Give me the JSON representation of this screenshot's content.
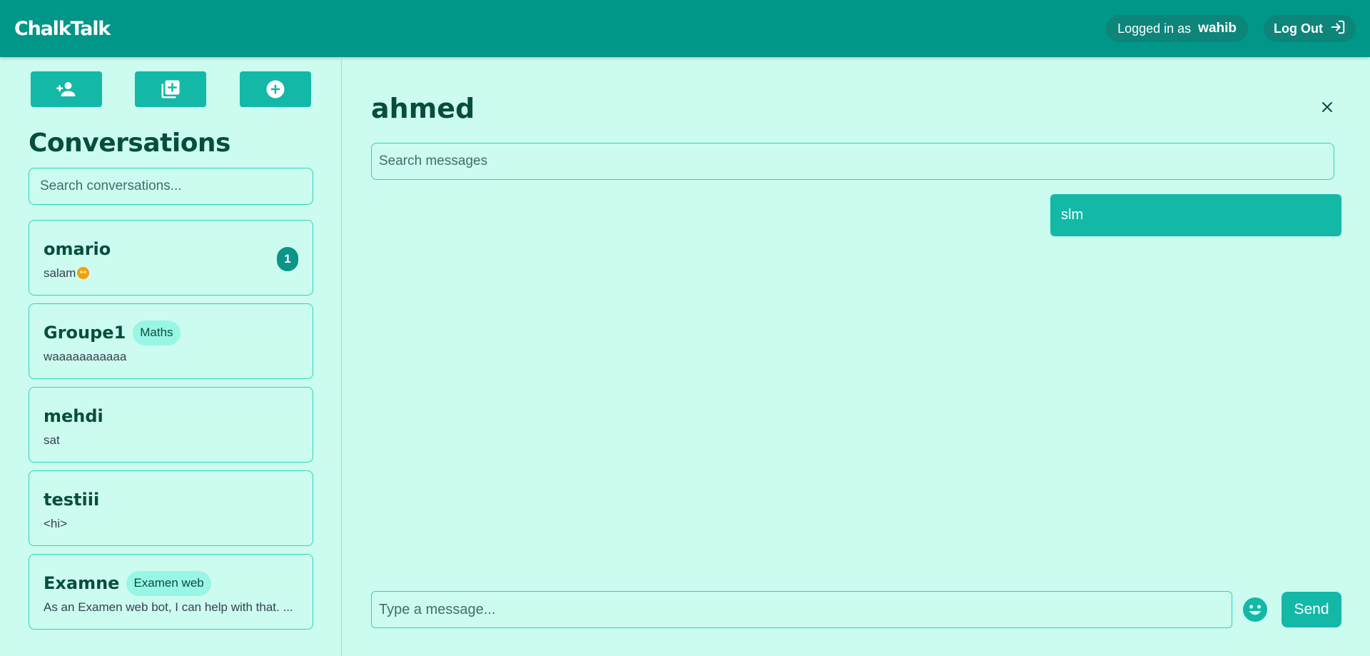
{
  "app": {
    "brand": "ChalkTalk"
  },
  "header": {
    "logged_in_label": "Logged in as",
    "username": "wahib",
    "logout_label": "Log Out",
    "logout_icon": "logout-icon"
  },
  "sidebar": {
    "action_icons": [
      "add-user-icon",
      "add-group-icon",
      "add-circle-icon"
    ],
    "title": "Conversations",
    "search_placeholder": "Search conversations...",
    "conversations": [
      {
        "name": "omario",
        "tag": "",
        "preview": "salam",
        "unread": "1",
        "preview_emoji": "emoji-face-icon"
      },
      {
        "name": "Groupe1",
        "tag": "Maths",
        "preview": "waaaaaaaaaaa",
        "unread": ""
      },
      {
        "name": "mehdi",
        "tag": "",
        "preview": "sat",
        "unread": ""
      },
      {
        "name": "testiii",
        "tag": "",
        "preview": "<hi>",
        "unread": ""
      },
      {
        "name": "Examne",
        "tag": "Examen web",
        "preview": "As an Examen web bot, I can help with that. ...",
        "unread": ""
      }
    ]
  },
  "chat": {
    "title": "ahmed",
    "close_icon": "close-icon",
    "search_placeholder": "Search messages",
    "messages": [
      {
        "text": "slm",
        "outgoing": true
      }
    ],
    "composer_placeholder": "Type a message...",
    "emoji_icon": "emoji-icon",
    "send_label": "Send"
  },
  "colors": {
    "header": "#009688",
    "background": "#ccfbef",
    "accent": "#14b8a6",
    "border": "#2dd4bf",
    "text_dark": "#064e3b",
    "tag_bg": "#99f6e4"
  }
}
